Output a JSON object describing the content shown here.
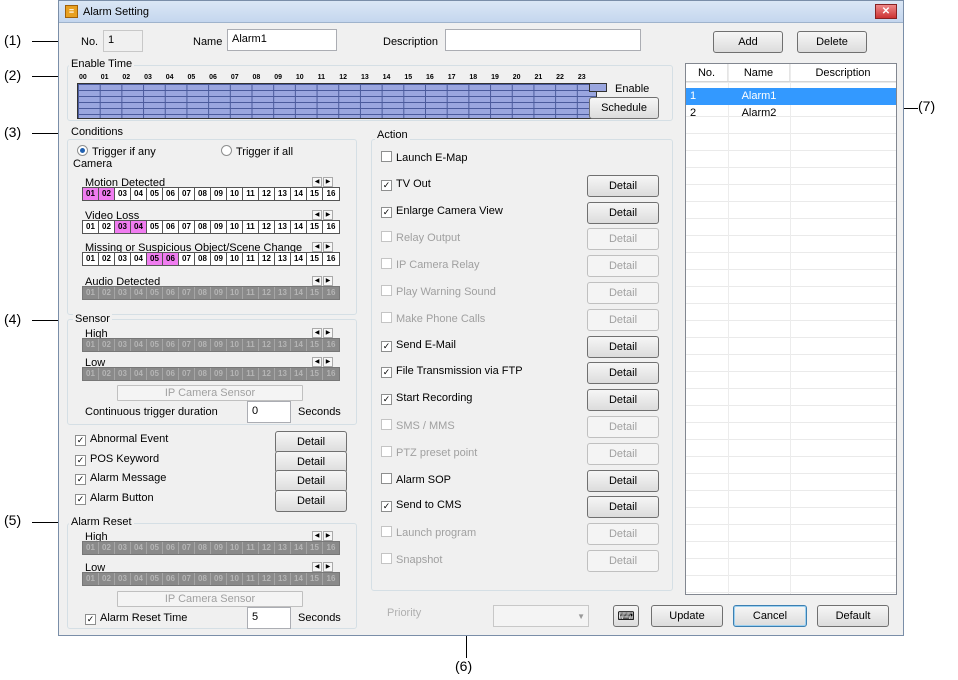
{
  "window": {
    "title": "Alarm Setting"
  },
  "annotations": {
    "a1": "(1)",
    "a2": "(2)",
    "a3": "(3)",
    "a4": "(4)",
    "a5": "(5)",
    "a6": "(6)",
    "a7": "(7)"
  },
  "top": {
    "no_label": "No.",
    "no_value": "1",
    "name_label": "Name",
    "name_value": "Alarm1",
    "desc_label": "Description",
    "desc_value": "",
    "add": "Add",
    "delete": "Delete"
  },
  "enable_time": {
    "title": "Enable Time",
    "hours": [
      "00",
      "01",
      "02",
      "03",
      "04",
      "05",
      "06",
      "07",
      "08",
      "09",
      "10",
      "11",
      "12",
      "13",
      "14",
      "15",
      "16",
      "17",
      "18",
      "19",
      "20",
      "21",
      "22",
      "23"
    ],
    "legend": "Enable",
    "schedule": "Schedule"
  },
  "conditions": {
    "title": "Conditions",
    "trigger_any": "Trigger if any",
    "trigger_all": "Trigger if all",
    "camera_title": "Camera",
    "motion": "Motion Detected",
    "video_loss": "Video Loss",
    "missing": "Missing or Suspicious Object/Scene Change",
    "audio": "Audio Detected",
    "channels": [
      "01",
      "02",
      "03",
      "04",
      "05",
      "06",
      "07",
      "08",
      "09",
      "10",
      "11",
      "12",
      "13",
      "14",
      "15",
      "16"
    ],
    "motion_on": [
      "01",
      "02"
    ],
    "video_loss_on": [
      "03",
      "04"
    ],
    "missing_on": [
      "05",
      "06"
    ]
  },
  "sensor": {
    "title": "Sensor",
    "high": "High",
    "low": "Low",
    "ip_sensor": "IP Camera Sensor",
    "duration_label": "Continuous trigger duration",
    "duration_value": "0",
    "seconds": "Seconds"
  },
  "events": {
    "abnormal": "Abnormal Event",
    "pos": "POS Keyword",
    "message": "Alarm Message",
    "button": "Alarm Button",
    "detail": "Detail"
  },
  "alarm_reset": {
    "title": "Alarm Reset",
    "high": "High",
    "low": "Low",
    "ip_sensor": "IP Camera Sensor",
    "reset_time_label": "Alarm Reset Time",
    "reset_time_value": "5",
    "seconds": "Seconds"
  },
  "action": {
    "title": "Action",
    "items": [
      {
        "label": "Launch E-Map",
        "checked": false,
        "enabled": true,
        "detail": false
      },
      {
        "label": "TV Out",
        "checked": true,
        "enabled": true,
        "detail": true
      },
      {
        "label": "Enlarge Camera View",
        "checked": true,
        "enabled": true,
        "detail": true
      },
      {
        "label": "Relay Output",
        "checked": false,
        "enabled": false,
        "detail": true
      },
      {
        "label": "IP Camera Relay",
        "checked": false,
        "enabled": false,
        "detail": true
      },
      {
        "label": "Play Warning Sound",
        "checked": false,
        "enabled": false,
        "detail": true
      },
      {
        "label": "Make Phone Calls",
        "checked": false,
        "enabled": false,
        "detail": true
      },
      {
        "label": "Send E-Mail",
        "checked": true,
        "enabled": true,
        "detail": true
      },
      {
        "label": "File Transmission via FTP",
        "checked": true,
        "enabled": true,
        "detail": true
      },
      {
        "label": "Start Recording",
        "checked": true,
        "enabled": true,
        "detail": true
      },
      {
        "label": "SMS / MMS",
        "checked": false,
        "enabled": false,
        "detail": true
      },
      {
        "label": "PTZ preset point",
        "checked": false,
        "enabled": false,
        "detail": true
      },
      {
        "label": "Alarm SOP",
        "checked": false,
        "enabled": true,
        "detail": true
      },
      {
        "label": "Send to CMS",
        "checked": true,
        "enabled": true,
        "detail": true
      },
      {
        "label": "Launch program",
        "checked": false,
        "enabled": false,
        "detail": true
      },
      {
        "label": "Snapshot",
        "checked": false,
        "enabled": false,
        "detail": true
      }
    ],
    "detail": "Detail"
  },
  "list": {
    "headers": [
      "No.",
      "Name",
      "Description"
    ],
    "rows": [
      {
        "no": "1",
        "name": "Alarm1",
        "desc": ""
      },
      {
        "no": "2",
        "name": "Alarm2",
        "desc": ""
      }
    ]
  },
  "bottom": {
    "priority": "Priority",
    "keyboard_icon": "keyboard-icon",
    "update": "Update",
    "cancel": "Cancel",
    "default": "Default"
  }
}
